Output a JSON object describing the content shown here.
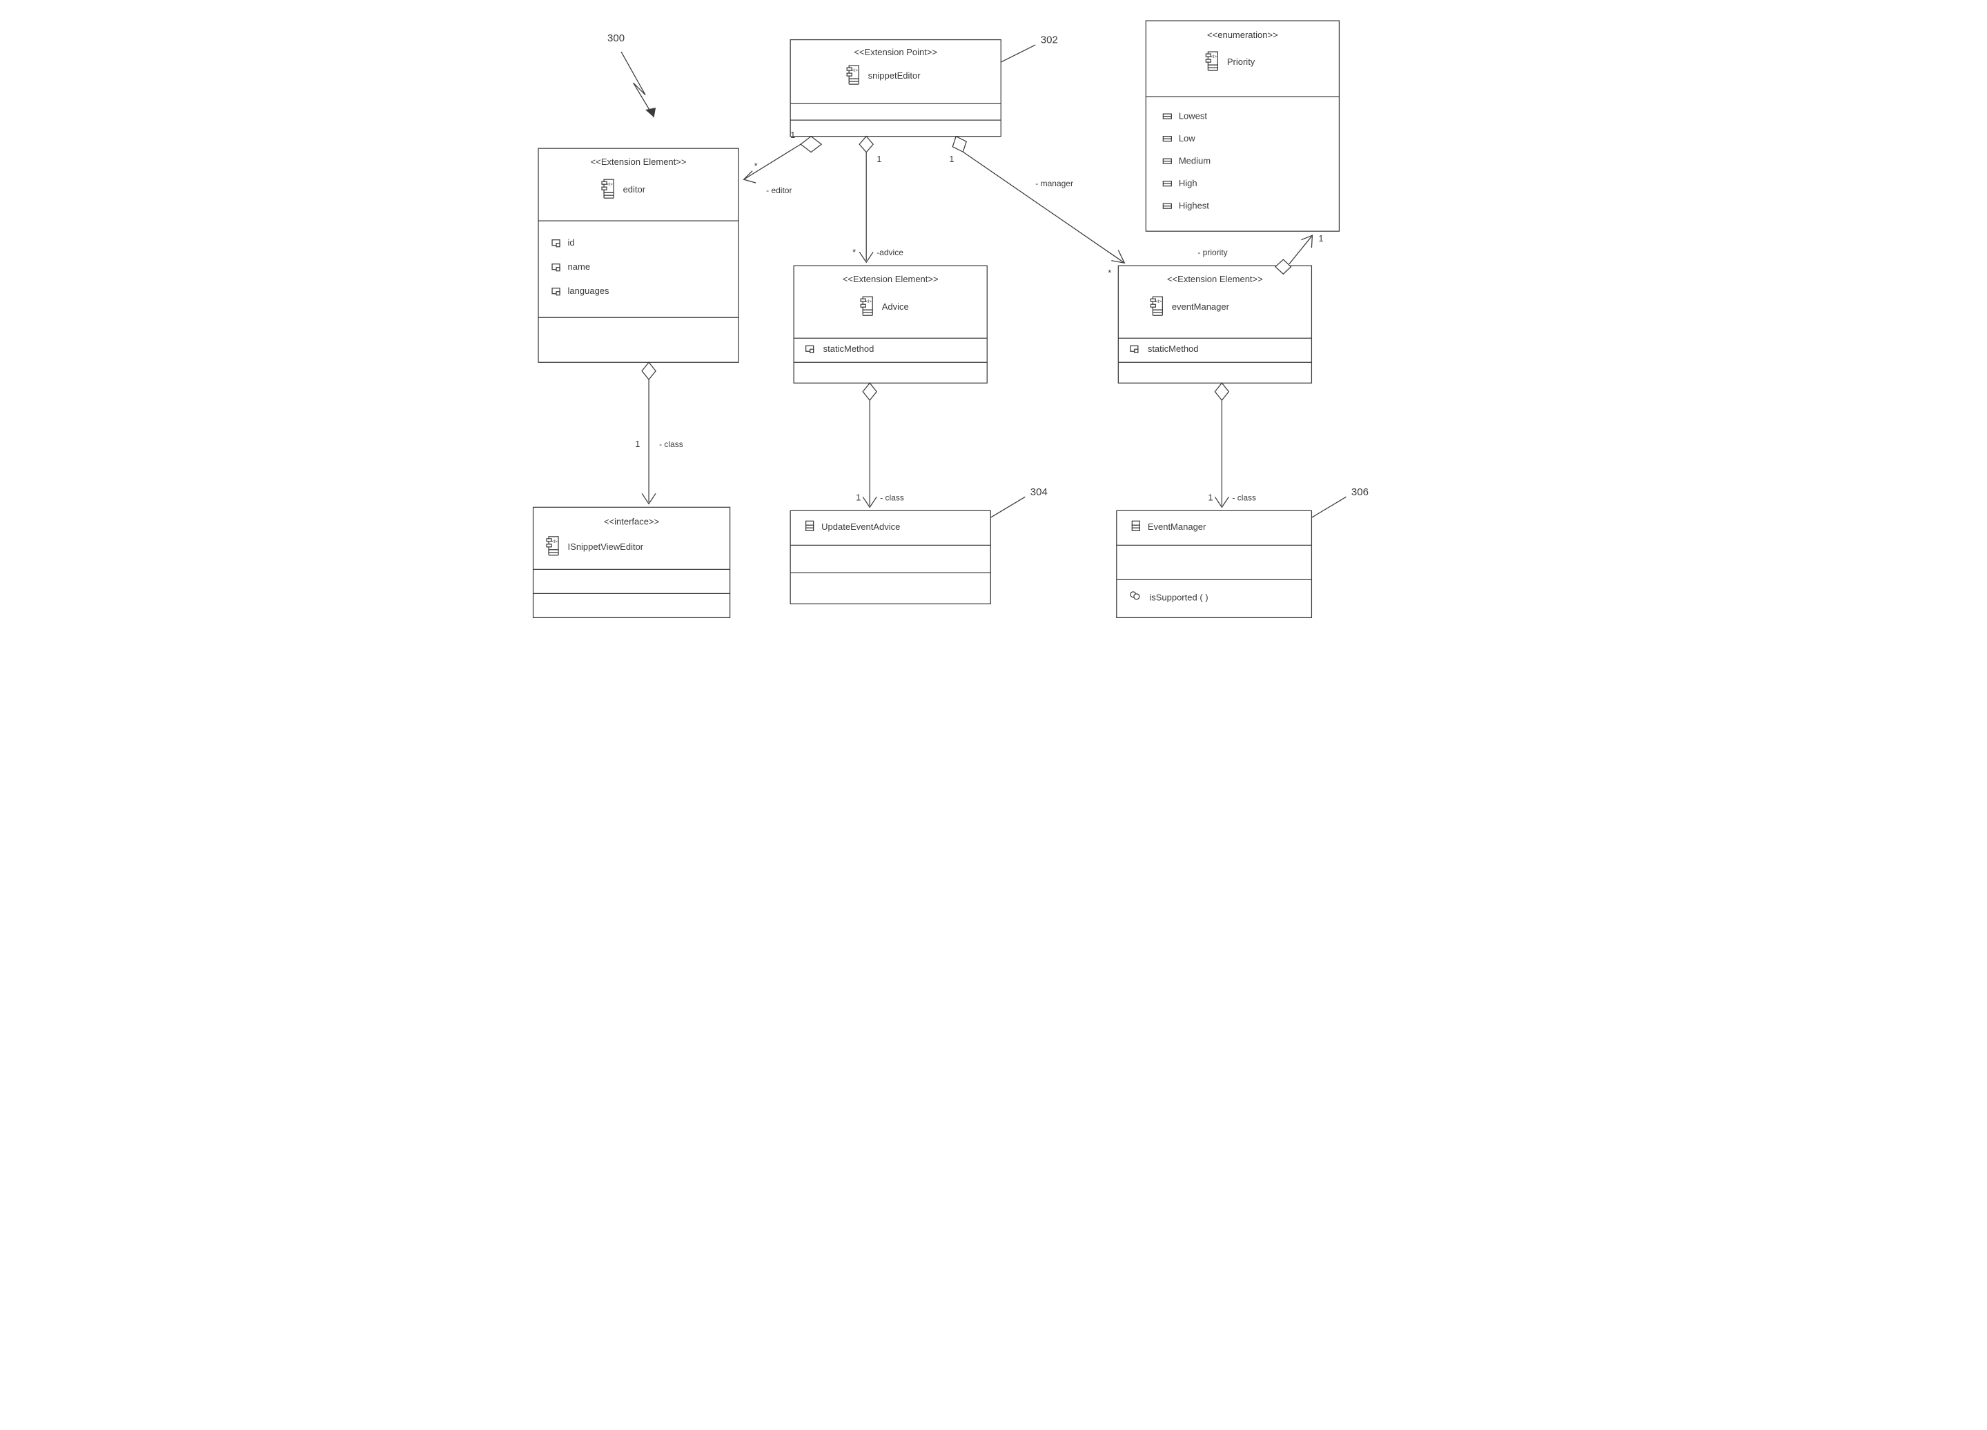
{
  "ref_300": "300",
  "ref_302": "302",
  "ref_304": "304",
  "ref_306": "306",
  "snippetEditor": {
    "stereo": "<<Extension Point>>",
    "name": "snippetEditor"
  },
  "editor": {
    "stereo": "<<Extension Element>>",
    "name": "editor",
    "attrs": [
      "id",
      "name",
      "languages"
    ]
  },
  "advice": {
    "stereo": "<<Extension Element>>",
    "name": "Advice",
    "attrs": [
      "staticMethod"
    ]
  },
  "eventManager": {
    "stereo": "<<Extension Element>>",
    "name": "eventManager",
    "attrs": [
      "staticMethod"
    ]
  },
  "priority": {
    "stereo": "<<enumeration>>",
    "name": "Priority",
    "vals": [
      "Lowest",
      "Low",
      "Medium",
      "High",
      "Highest"
    ]
  },
  "isnippet": {
    "stereo": "<<interface>>",
    "name": "ISnippetViewEditor"
  },
  "updateAdvice": {
    "name": "UpdateEventAdvice"
  },
  "eventMgrClass": {
    "name": "EventManager",
    "op": "isSupported ( )"
  },
  "labels": {
    "editorRole": "- editor",
    "adviceRole": "-advice",
    "managerRole": "- manager",
    "classRole": "- class",
    "priorityRole": "- priority",
    "one": "1",
    "many": "*"
  }
}
